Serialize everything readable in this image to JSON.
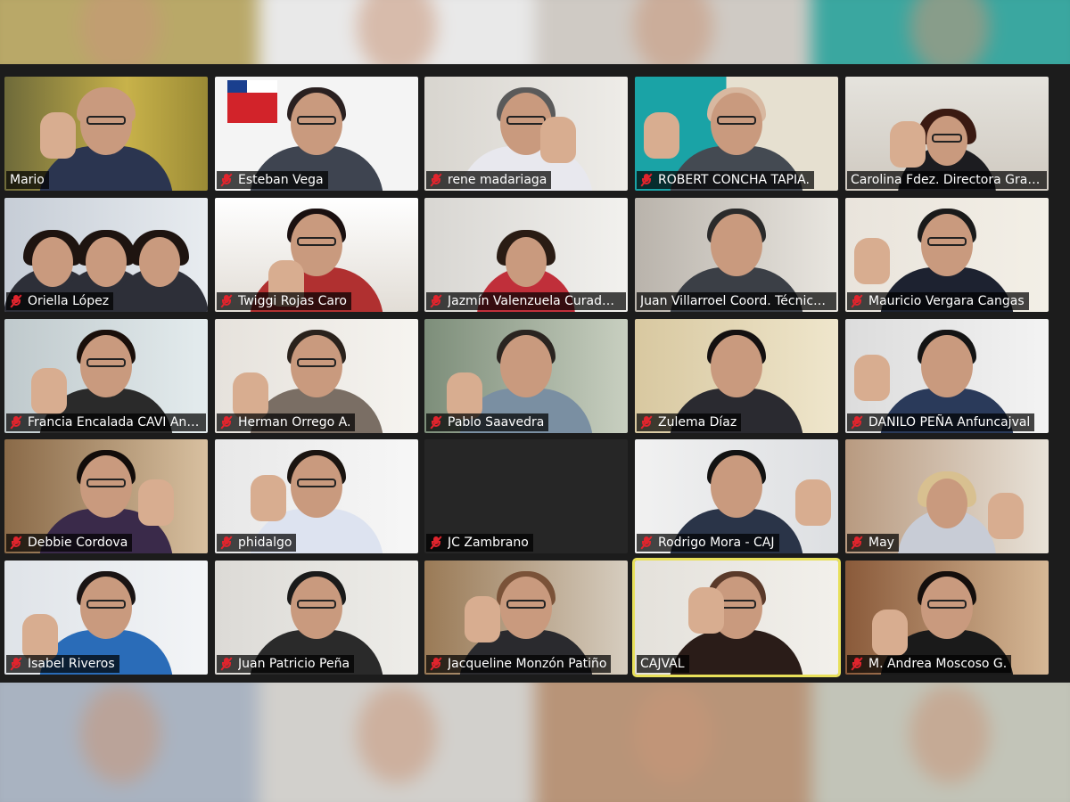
{
  "meeting": {
    "participants": [
      {
        "name": "Mario",
        "muted": false
      },
      {
        "name": "Esteban Vega",
        "muted": true
      },
      {
        "name": "rene madariaga",
        "muted": true
      },
      {
        "name": "ROBERT CONCHA TAPIA.",
        "muted": true
      },
      {
        "name": "Carolina Fdez. Directora Gral. …",
        "muted": false
      },
      {
        "name": "Oriella López",
        "muted": true
      },
      {
        "name": "Twiggi Rojas Caro",
        "muted": true
      },
      {
        "name": "Jazmín Valenzuela Curador…",
        "muted": true
      },
      {
        "name": "Juan Villarroel Coord. Técnico…",
        "muted": false
      },
      {
        "name": "Mauricio Vergara Cangas",
        "muted": true
      },
      {
        "name": "Francia Encalada CAVI Anto…",
        "muted": true
      },
      {
        "name": "Herman Orrego A.",
        "muted": true
      },
      {
        "name": "Pablo Saavedra",
        "muted": true
      },
      {
        "name": "Zulema Díaz",
        "muted": true
      },
      {
        "name": "DANILO PEÑA Anfuncajval",
        "muted": true
      },
      {
        "name": "Debbie Cordova",
        "muted": true
      },
      {
        "name": "phidalgo",
        "muted": true
      },
      {
        "name": "JC Zambrano",
        "muted": true
      },
      {
        "name": "Rodrigo Mora - CAJ",
        "muted": true
      },
      {
        "name": "May",
        "muted": true
      },
      {
        "name": "Isabel Riveros",
        "muted": true
      },
      {
        "name": "Juan Patricio Peña",
        "muted": true
      },
      {
        "name": "Jacqueline Monzón Patiño",
        "muted": true
      },
      {
        "name": "CAJVAL",
        "muted": false,
        "active_speaker": true
      },
      {
        "name": "M. Andrea Moscoso G.",
        "muted": true
      }
    ],
    "colors": {
      "muted_icon": "#e0242d",
      "active_speaker_border": "#e8e05a",
      "label_bg": "rgba(0,0,0,0.72)"
    }
  }
}
